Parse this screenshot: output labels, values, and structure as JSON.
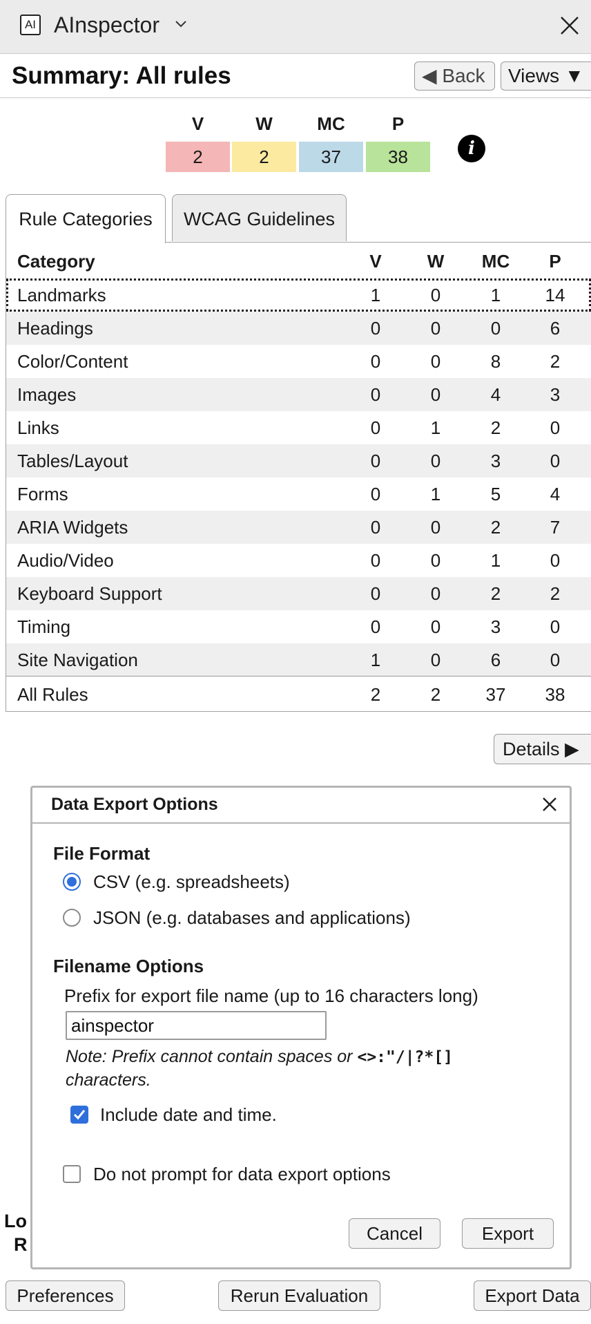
{
  "app": {
    "logo_text": "AI",
    "title": "AInspector"
  },
  "header": {
    "title": "Summary: All rules",
    "back_label": "◀ Back",
    "views_label": "Views ▼"
  },
  "summary": {
    "labels": [
      "V",
      "W",
      "MC",
      "P"
    ],
    "values": [
      "2",
      "2",
      "37",
      "38"
    ],
    "colors": [
      "#f4b6b6",
      "#fbeaa0",
      "#bcd9e8",
      "#b8e39a"
    ],
    "info_glyph": "i"
  },
  "tabs": [
    {
      "label": "Rule Categories",
      "selected": true
    },
    {
      "label": "WCAG Guidelines",
      "selected": false
    }
  ],
  "table": {
    "headers": [
      "Category",
      "V",
      "W",
      "MC",
      "P"
    ],
    "rows": [
      [
        "Landmarks",
        "1",
        "0",
        "1",
        "14"
      ],
      [
        "Headings",
        "0",
        "0",
        "0",
        "6"
      ],
      [
        "Color/Content",
        "0",
        "0",
        "8",
        "2"
      ],
      [
        "Images",
        "0",
        "0",
        "4",
        "3"
      ],
      [
        "Links",
        "0",
        "1",
        "2",
        "0"
      ],
      [
        "Tables/Layout",
        "0",
        "0",
        "3",
        "0"
      ],
      [
        "Forms",
        "0",
        "1",
        "5",
        "4"
      ],
      [
        "ARIA Widgets",
        "0",
        "0",
        "2",
        "7"
      ],
      [
        "Audio/Video",
        "0",
        "0",
        "1",
        "0"
      ],
      [
        "Keyboard Support",
        "0",
        "0",
        "2",
        "2"
      ],
      [
        "Timing",
        "0",
        "0",
        "3",
        "0"
      ],
      [
        "Site Navigation",
        "1",
        "0",
        "6",
        "0"
      ]
    ],
    "total": [
      "All Rules",
      "2",
      "2",
      "37",
      "38"
    ]
  },
  "details_label": "Details ▶",
  "behind": {
    "frag1": "Lo",
    "frag2": "R"
  },
  "dialog": {
    "title": "Data Export Options",
    "file_format_heading": "File Format",
    "options": [
      "CSV (e.g. spreadsheets)",
      "JSON (e.g. databases and applications)"
    ],
    "selected_option": "CSV (e.g. spreadsheets)",
    "filename_heading": "Filename Options",
    "prefix_label": "Prefix for export file name (up to 16 characters long)",
    "prefix_value": "ainspector",
    "note_text": "Note: Prefix cannot contain spaces or",
    "note_chars": "<>:\"/|?*[]",
    "note_tail": "characters.",
    "include_date_label": "Include date and time.",
    "include_date_checked": true,
    "no_prompt_label": "Do not prompt for data export options",
    "no_prompt_checked": false,
    "cancel_label": "Cancel",
    "export_label": "Export"
  },
  "footer": {
    "preferences": "Preferences",
    "rerun": "Rerun Evaluation",
    "export_data": "Export Data"
  }
}
